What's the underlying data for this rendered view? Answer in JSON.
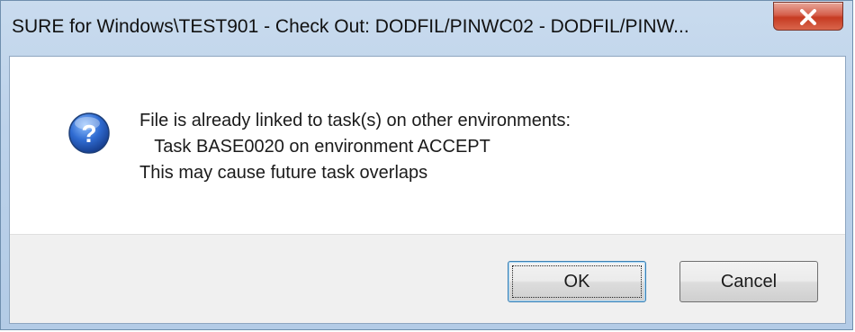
{
  "window": {
    "title": "SURE for Windows\\TEST901 - Check Out: DODFIL/PINWC02 - DODFIL/PINW..."
  },
  "dialog": {
    "icon": "question-icon",
    "message_lines": [
      "File is already linked to task(s) on other environments:",
      "   Task BASE0020 on environment ACCEPT",
      "This may cause future task overlaps"
    ]
  },
  "buttons": {
    "ok_label": "OK",
    "cancel_label": "Cancel"
  },
  "colors": {
    "close_button": "#c63b22",
    "icon_blue": "#2f6bd1",
    "footer_bg": "#f0f0f0",
    "title_bar": "#bcd2ea"
  }
}
